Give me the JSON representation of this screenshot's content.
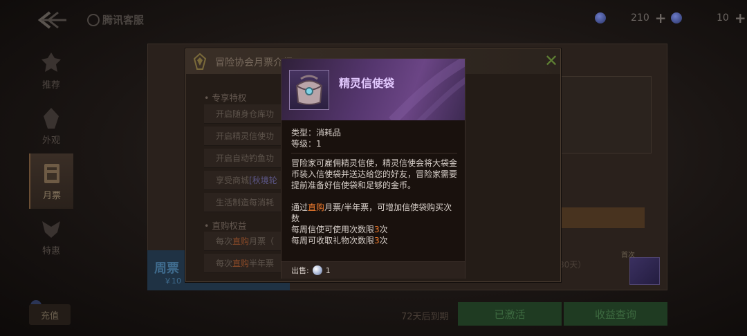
{
  "topbar": {
    "brand": "腾讯客服",
    "currency1": "210",
    "currency2": "10",
    "plus_glyph": "+",
    "icons": [
      "back-arrow-icon",
      "gem-icon",
      "plus-icon"
    ]
  },
  "nav": {
    "items": [
      {
        "label": "推荐",
        "icon": "recommend-icon"
      },
      {
        "label": "外观",
        "icon": "appearance-icon"
      },
      {
        "label": "月票",
        "icon": "monthly-ticket-icon",
        "active": true
      },
      {
        "label": "特惠",
        "icon": "special-offer-icon"
      }
    ],
    "recharge": "充值"
  },
  "background": {
    "weekly_ticket": "周票",
    "weekly_price": "￥10",
    "day_suffix": "80天）",
    "corner_tag": "首次",
    "expire": "72天后到期",
    "activated_button": "已激活",
    "earnings_button": "收益查询"
  },
  "dialog": {
    "title": "冒险协会月票介绍",
    "close_glyph": "✕",
    "section1": "专享特权",
    "rows1": [
      "开启随身仓库功",
      "开启精灵信使功",
      "开启自动钓鱼功"
    ],
    "row_shop_prefix": "享受商城",
    "row_shop_highlight": "[秋境轮",
    "row_craft": "生活制造每消耗",
    "section2": "直购权益",
    "row_monthly_prefix": "每次",
    "row_monthly_highlight": "直购",
    "row_monthly_suffix": "月票（",
    "row_half_prefix": "每次",
    "row_half_highlight": "直购",
    "row_half_suffix": "半年票"
  },
  "tooltip": {
    "name": "精灵信使袋",
    "type": "类型：消耗品",
    "level": "等级：1",
    "description": "冒险家可雇佣精灵信使，精灵信使会将大袋金币装入信使袋并送达给您的好友，冒险家需要提前准备好信使袋和足够的金币。",
    "note_prefix": "通过",
    "note_highlight": "直购",
    "note_suffix": "月票/半年票，可增加信使袋购买次数",
    "limit1_prefix": "每周信使可使用次数限",
    "limit1_value": "3",
    "limit1_suffix": "次",
    "limit2_prefix": "每周可收取礼物次数限",
    "limit2_value": "3",
    "limit2_suffix": "次",
    "sell_label": "出售:",
    "sell_price": "1",
    "accent_color": "#e3c9ff",
    "highlight_color": "#f07c2e"
  }
}
